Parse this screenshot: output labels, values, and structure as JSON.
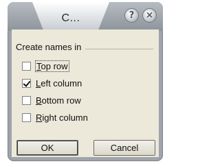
{
  "dialog": {
    "title": "C...",
    "help_glyph": "?",
    "close_glyph": "×",
    "group_label": "Create names in",
    "options": [
      {
        "prefix": "",
        "accel": "T",
        "rest": "op row",
        "checked": false
      },
      {
        "prefix": "",
        "accel": "L",
        "rest": "eft column",
        "checked": true
      },
      {
        "prefix": "",
        "accel": "B",
        "rest": "ottom row",
        "checked": false
      },
      {
        "prefix": "",
        "accel": "R",
        "rest": "ight column",
        "checked": false
      }
    ],
    "ok_label": "OK",
    "cancel_label": "Cancel"
  }
}
